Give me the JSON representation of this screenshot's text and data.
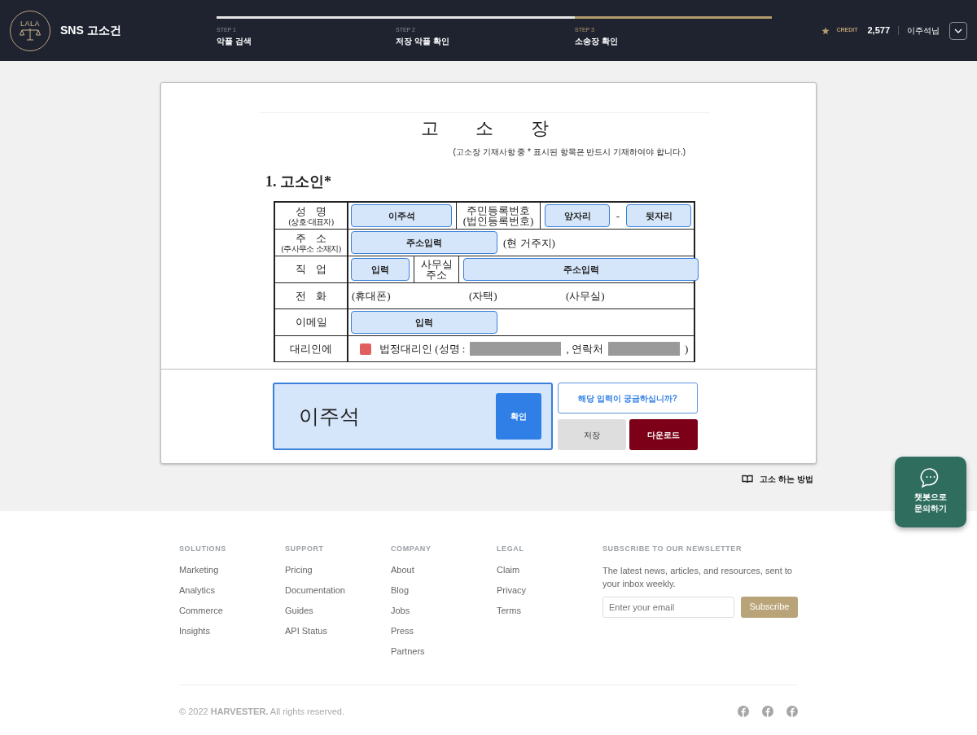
{
  "header": {
    "logo_text": "LALA",
    "title": "SNS 고소건",
    "steps": [
      {
        "number": "STEP 1",
        "label": "악플 검색",
        "selected": false
      },
      {
        "number": "STEP 2",
        "label": "저장 악플 확인",
        "selected": false
      },
      {
        "number": "STEP 3",
        "label": "소송장 확인",
        "selected": true
      }
    ],
    "credit_label": "CREDIT",
    "credit": "2,577",
    "user": "이주석님"
  },
  "document": {
    "title": "고 소 장",
    "note": "(고소장 기재사항 중 * 표시된 항목은 반드시 기재하여야 합니다.)",
    "section": "1. 고소인*",
    "form_lines": [
      {
        "label": [
          "성 명",
          "(상호·대표자)"
        ],
        "parts": [
          {
            "kind": "field",
            "text": "이주석"
          },
          {
            "kind": "label",
            "lines": [
              "주민등록번호",
              "(법인등록번호)"
            ]
          },
          {
            "kind": "field",
            "text": "앞자리"
          },
          {
            "kind": "text",
            "text": "-"
          },
          {
            "kind": "field",
            "text": "뒷자리"
          }
        ]
      },
      {
        "label": [
          "주 소",
          "(주사무소 소재지)"
        ],
        "parts": [
          {
            "kind": "field",
            "text": "주소입력"
          },
          {
            "kind": "text",
            "text": "(현 거주지)"
          }
        ]
      },
      {
        "label": [
          "직 업"
        ],
        "parts": [
          {
            "kind": "field",
            "text": "입력"
          },
          {
            "kind": "label",
            "lines": [
              "사무실",
              "주소"
            ]
          },
          {
            "kind": "field",
            "text": "주소입력"
          }
        ]
      },
      {
        "label": [
          "전 화"
        ],
        "parts": [
          {
            "kind": "text",
            "text": "(휴대폰)"
          },
          {
            "kind": "text",
            "text": "(자택)"
          },
          {
            "kind": "text",
            "text": "(사무실)"
          }
        ]
      },
      {
        "label": [
          "이메일"
        ],
        "parts": [
          {
            "kind": "field",
            "text": "입력"
          }
        ]
      },
      {
        "label": [
          "대리인에"
        ],
        "parts": [
          {
            "kind": "marker"
          },
          {
            "kind": "text",
            "text": "법정대리인 (성명 :"
          },
          {
            "kind": "redacted"
          },
          {
            "kind": "text",
            "text": ", 연락처"
          },
          {
            "kind": "redacted"
          },
          {
            "kind": "text",
            "text": ")"
          }
        ]
      }
    ]
  },
  "input_panel": {
    "value": "이주석",
    "confirm": "확인",
    "help": "해당 입력이 궁금하십니까?",
    "save": "저장",
    "download": "다운로드"
  },
  "guide_link": "고소 하는 방법",
  "chatbot": "챗봇으로\n문의하기",
  "footer": {
    "columns": [
      {
        "heading": "SOLUTIONS",
        "links": [
          "Marketing",
          "Analytics",
          "Commerce",
          "Insights"
        ]
      },
      {
        "heading": "SUPPORT",
        "links": [
          "Pricing",
          "Documentation",
          "Guides",
          "API Status"
        ]
      },
      {
        "heading": "COMPANY",
        "links": [
          "About",
          "Blog",
          "Jobs",
          "Press",
          "Partners"
        ]
      },
      {
        "heading": "LEGAL",
        "links": [
          "Claim",
          "Privacy",
          "Terms"
        ]
      }
    ],
    "newsletter": {
      "heading": "SUBSCRIBE TO OUR NEWSLETTER",
      "text": "The latest news, articles, and resources, sent to your inbox weekly.",
      "placeholder": "Enter your email",
      "button": "Subscribe"
    },
    "copyright": "© 2022 **HARVESTER.** All rights reserved."
  }
}
